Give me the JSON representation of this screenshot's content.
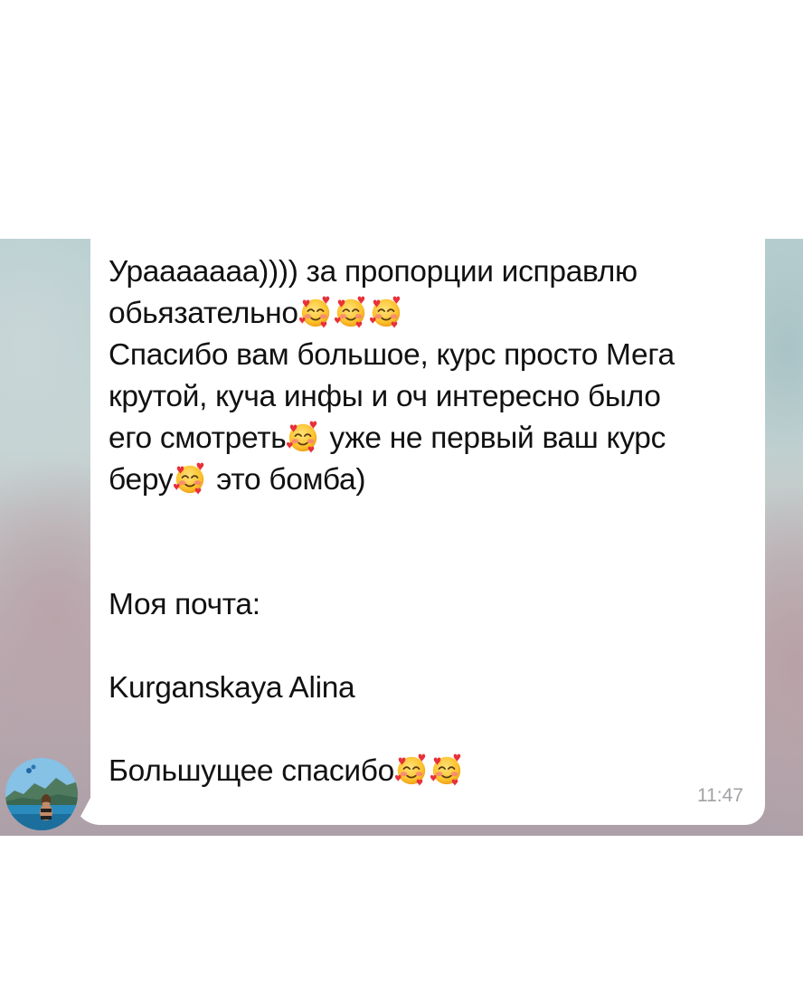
{
  "message": {
    "paragraph1": [
      {
        "text": "Урааааааа)))) за пропорции исправлю",
        "emojis": 0
      },
      {
        "text": "обьязательно",
        "emojis": 3
      },
      {
        "text": "Спасибо вам большое, курс просто Мега",
        "emojis": 0
      },
      {
        "text": "крутой, куча инфы и оч интересно было",
        "emojis": 0
      },
      {
        "text_before": "его смотреть",
        "text_after": " уже не первый ваш курс"
      },
      {
        "text_before": "беру",
        "text_after": " это бомба)"
      }
    ],
    "email_label": "Моя почта:",
    "name": "Kurganskaya Alina",
    "thanks": "Большущее спасибо",
    "thanks_emojis": 2,
    "time": "11:47"
  },
  "icons": {
    "reaction_emoji": "smiling-face-with-hearts-icon"
  },
  "colors": {
    "bubble": "#ffffff",
    "text": "#111111",
    "time": "#a2a2a6"
  }
}
